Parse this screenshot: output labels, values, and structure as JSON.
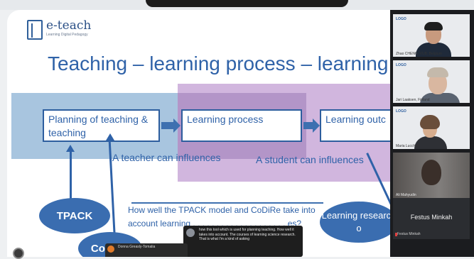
{
  "slide": {
    "logo": {
      "name": "e-teach",
      "subtitle": "Learning Digital Pedagogy"
    },
    "title": "Teaching – learning process – learning ou",
    "boxes": [
      "Planning of teaching & teaching",
      "Learning process",
      "Learning outc"
    ],
    "captions": [
      "A teacher can influences",
      "A student can influences"
    ],
    "ellipses": {
      "tpack": "TPACK",
      "codire": "CoDiRe",
      "learning": "Learning research o"
    },
    "note_line1": "How well the TPACK model and CoDiRe take into",
    "note_line2": "account learning . . . . . . . . . . . . . . . . . . . . es?"
  },
  "chat": {
    "message1": "how this tool which is used for planning teaching. How well it takes into account. The courses of learning science research. That is what I'm a kind of asking",
    "message2": "Donna Greasly-Tomalia"
  },
  "participants": [
    {
      "name": "Zhao CHENG, VUB, Belgium"
    },
    {
      "name": "Jari Laaksen, Finland"
    },
    {
      "name": "Maria Lucchetti"
    },
    {
      "name": "Ali Mahyudin"
    },
    {
      "name": "Festus Minkah",
      "label": "Festus Minkah"
    }
  ],
  "tile_logo": "LOGO"
}
